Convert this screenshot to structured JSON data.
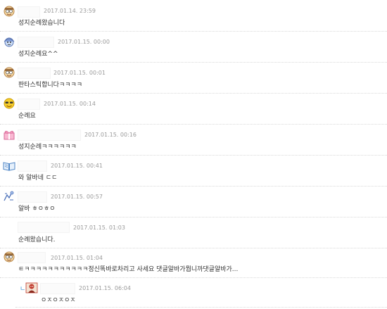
{
  "comments": [
    {
      "id": "c1",
      "date": "2017.01.14. 23:59",
      "text": "성지순례왔습니다",
      "avatar": "smiley-glasses-icon",
      "accent": "#e8b46a"
    },
    {
      "id": "c2",
      "date": "2017.01.15. 00:00",
      "text": "성지순례요^^",
      "avatar": "smiley-helmet-icon",
      "accent": "#7f9bd6"
    },
    {
      "id": "c3",
      "date": "2017.01.15. 00:01",
      "text": "판타스틱합니다ㅋㅋㅋㅋ",
      "avatar": "smiley-glasses-icon",
      "accent": "#e8b46a"
    },
    {
      "id": "c4",
      "date": "2017.01.15. 00:14",
      "text": "순례요",
      "avatar": "smiley-sunglasses-icon",
      "accent": "#f2c500"
    },
    {
      "id": "c5",
      "date": "2017.01.15. 00:16",
      "text": "성지순례ㅋㅋㅋㅋㅋㅋ",
      "avatar": "gift-icon",
      "accent": "#f59abf"
    },
    {
      "id": "c6",
      "date": "2017.01.15. 00:41",
      "text": "와 알바네 ㄷㄷ",
      "avatar": "book-icon",
      "accent": "#6fa7dc"
    },
    {
      "id": "c7",
      "date": "2017.01.15. 00:57",
      "text": "알바 ㅎㅇㅎㅇ",
      "avatar": "doodle-icon",
      "accent": "#6a8fd0"
    },
    {
      "id": "c8",
      "date": "2017.01.15. 01:03",
      "text": "순례왔습니다.",
      "avatar": "",
      "accent": ""
    },
    {
      "id": "c9",
      "date": "2017.01.15. 01:04",
      "text": "ㅌㅋㅋㅋㅋㅋㅋㅋㅋㅋㅋㅋ정신똑바로차리고 사세요 댓글알바가뭡니까댓글알바가...",
      "avatar": "smiley-glasses-icon",
      "accent": "#e8b46a"
    },
    {
      "id": "c10",
      "date": "2017.01.15. 06:04",
      "text": "ㅇㅈㅇㅈㅇㅈ",
      "avatar": "character-icon",
      "accent": "#c0392b",
      "reply": true,
      "reply_symbol": "ㄴ"
    }
  ]
}
